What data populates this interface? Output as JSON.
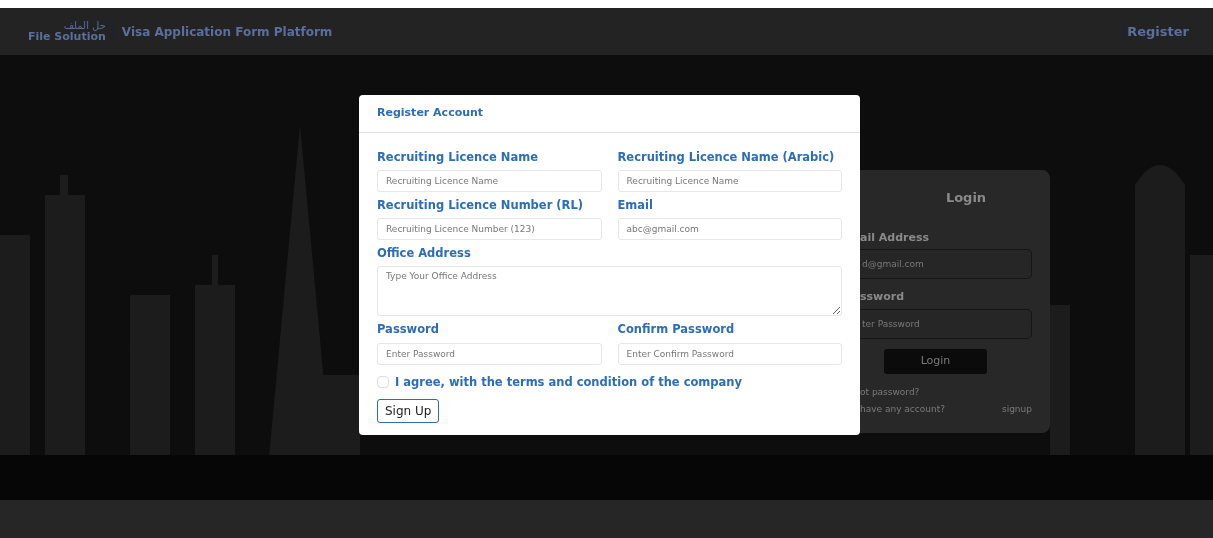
{
  "navbar": {
    "logo_arabic": "حل الملف",
    "logo_text": "File Solution",
    "title": "Visa Application Form Platform",
    "register_link": "Register"
  },
  "login_card": {
    "title": "Login",
    "email_label": "ail Address",
    "email_placeholder": "d@gmail.com",
    "password_label": "ssword",
    "password_placeholder": "ter Password",
    "login_button": "Login",
    "forgot_link": "ot password?",
    "account_text": "have any account?",
    "signup_link": "signup"
  },
  "modal": {
    "title": "Register Account",
    "fields": [
      {
        "kind": "input",
        "label": "Recruiting Licence Name",
        "placeholder": "Recruiting Licence Name"
      },
      {
        "kind": "input",
        "label": "Recruiting Licence Name (Arabic)",
        "placeholder": "Recruiting Licence Name"
      },
      {
        "kind": "input",
        "label": "Recruiting Licence Number (RL)",
        "placeholder": "Recruiting Licence Number (123)"
      },
      {
        "kind": "input",
        "label": "Email",
        "placeholder": "abc@gmail.com"
      },
      {
        "kind": "textarea",
        "label": "Office Address",
        "placeholder": "Type Your Office Address"
      },
      {
        "kind": "input",
        "label": "Password",
        "placeholder": "Enter Password"
      },
      {
        "kind": "input",
        "label": "Confirm Password",
        "placeholder": "Enter Confirm Password"
      }
    ],
    "agree": {
      "label": "I agree, with the terms and condition of the company",
      "checked": false
    },
    "submit": "Sign Up"
  }
}
